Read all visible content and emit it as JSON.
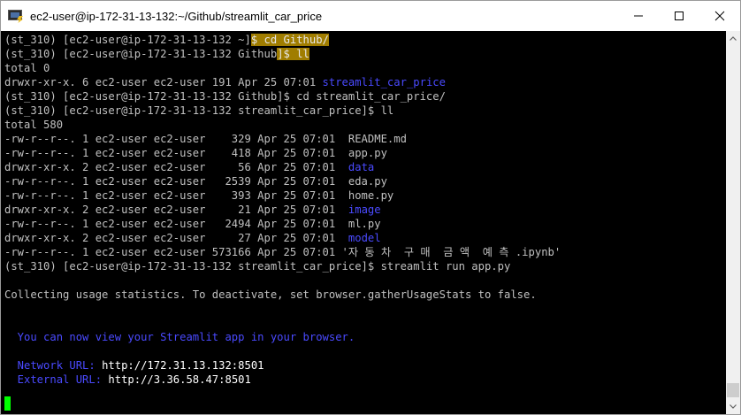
{
  "window": {
    "title": "ec2-user@ip-172-31-13-132:~/Github/streamlit_car_price",
    "controls": {
      "minimize_icon": "minimize-icon",
      "maximize_icon": "maximize-icon",
      "close_icon": "close-icon"
    }
  },
  "colors": {
    "background": "#000000",
    "text": "#c0c0c0",
    "highlight": "#a07d00",
    "blue": "#4a4aff",
    "cursor": "#00ff00",
    "white": "#ffffff"
  },
  "terminal": {
    "lines": [
      [
        {
          "t": "(st_310) [ec2-user@ip-172-31-13-132 ~]"
        },
        {
          "t": "$ cd Github/",
          "c": "hl"
        }
      ],
      [
        {
          "t": "(st_310) [ec2-user@ip-172-31-13-132 Github"
        },
        {
          "t": "]$ ll",
          "c": "hl"
        }
      ],
      [
        {
          "t": "total 0"
        }
      ],
      [
        {
          "t": "drwxr-xr-x. 6 ec2-user ec2-user 191 Apr 25 07:01 "
        },
        {
          "t": "streamlit_car_price",
          "c": "blue"
        }
      ],
      [
        {
          "t": "(st_310) [ec2-user@ip-172-31-13-132 Github]$ cd streamlit_car_price/"
        }
      ],
      [
        {
          "t": "(st_310) [ec2-user@ip-172-31-13-132 streamlit_car_price]$ ll"
        }
      ],
      [
        {
          "t": "total 580"
        }
      ],
      [
        {
          "t": "-rw-r--r--. 1 ec2-user ec2-user    329 Apr 25 07:01  README.md"
        }
      ],
      [
        {
          "t": "-rw-r--r--. 1 ec2-user ec2-user    418 Apr 25 07:01  app.py"
        }
      ],
      [
        {
          "t": "drwxr-xr-x. 2 ec2-user ec2-user     56 Apr 25 07:01  "
        },
        {
          "t": "data",
          "c": "blue"
        }
      ],
      [
        {
          "t": "-rw-r--r--. 1 ec2-user ec2-user   2539 Apr 25 07:01  eda.py"
        }
      ],
      [
        {
          "t": "-rw-r--r--. 1 ec2-user ec2-user    393 Apr 25 07:01  home.py"
        }
      ],
      [
        {
          "t": "drwxr-xr-x. 2 ec2-user ec2-user     21 Apr 25 07:01  "
        },
        {
          "t": "image",
          "c": "blue"
        }
      ],
      [
        {
          "t": "-rw-r--r--. 1 ec2-user ec2-user   2494 Apr 25 07:01  ml.py"
        }
      ],
      [
        {
          "t": "drwxr-xr-x. 2 ec2-user ec2-user     27 Apr 25 07:01  "
        },
        {
          "t": "model",
          "c": "blue"
        }
      ],
      [
        {
          "t": "-rw-r--r--. 1 ec2-user ec2-user 573166 Apr 25 07:01 '자 동 차  구 매  금 액  예 측 .ipynb'"
        }
      ],
      [
        {
          "t": "(st_310) [ec2-user@ip-172-31-13-132 streamlit_car_price]$ streamlit run app.py"
        }
      ],
      [
        {
          "t": ""
        }
      ],
      [
        {
          "t": "Collecting usage statistics. To deactivate, set browser.gatherUsageStats to false."
        }
      ],
      [
        {
          "t": ""
        }
      ],
      [
        {
          "t": ""
        }
      ],
      [
        {
          "t": "  You can now view your Streamlit app in your browser.",
          "c": "blue"
        }
      ],
      [
        {
          "t": ""
        }
      ],
      [
        {
          "t": "  Network URL: ",
          "c": "blue"
        },
        {
          "t": "http://172.31.13.132:8501",
          "c": "white"
        }
      ],
      [
        {
          "t": "  External URL: ",
          "c": "blue"
        },
        {
          "t": "http://3.36.58.47:8501",
          "c": "white"
        }
      ]
    ]
  }
}
